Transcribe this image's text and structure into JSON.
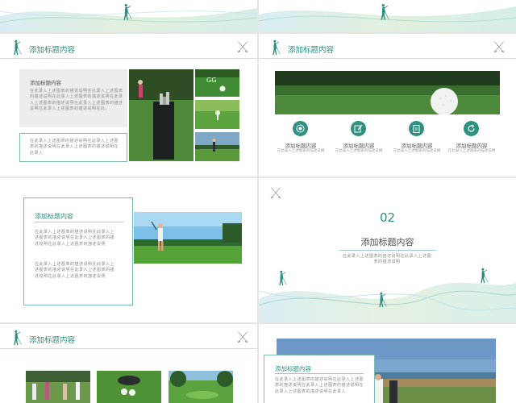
{
  "colors": {
    "accent": "#2d8e7f",
    "icon_bg": "#2f9280",
    "text_gray": "#8a8f8e"
  },
  "slide2": {
    "title": "添加标题内容",
    "box_title": "添加标题内容",
    "box_text": "在此录入上述图表的描述说明在此录入上述图表的描述说明在此录入上述图表的描述说明在此录入上述图表的描述说明在此录入上述图表的描述说明在此录入上述图表的描述说明在此。",
    "lower_text": "在此录入上述图表的描述说明在此录入上述图表的描述说明在此录入上述图表的描述说明在此录入"
  },
  "slide3": {
    "title": "添加标题内容",
    "features": [
      {
        "icon": "target-icon",
        "title": "添加标题内容",
        "desc": "在此录入上述图表的描述说明"
      },
      {
        "icon": "edit-icon",
        "title": "添加标题内容",
        "desc": "在此录入上述图表的描述说明"
      },
      {
        "icon": "clipboard-icon",
        "title": "添加标题内容",
        "desc": "在此录入上述图表的描述说明"
      },
      {
        "icon": "refresh-icon",
        "title": "添加标题内容",
        "desc": "在此录入上述图表的描述说明"
      }
    ]
  },
  "slide4": {
    "title": "添加标题内容",
    "para1": "在此录入上述图表的描述说明在此录入上述图表的描述说明在此录入上述图表的描述说明在此录入上述图表的描述说明",
    "para2": "在此录入上述图表的描述说明在此录入上述图表的描述说明在此录入上述图表的描述说明在此录入上述图表的描述说明"
  },
  "slide5": {
    "number": "02",
    "title": "添加标题内容",
    "desc": "在此录入上述图表的描述说明在此录入上述图表的描述说明"
  },
  "slide6": {
    "title": "添加标题内容"
  },
  "slide7": {
    "box_title": "添加标题内容",
    "box_text": "在此录入上述图表的描述说明在此录入上述图表的描述说明在此录入上述图表的描述说明在此录入上述图表的描述说明在此录入"
  }
}
